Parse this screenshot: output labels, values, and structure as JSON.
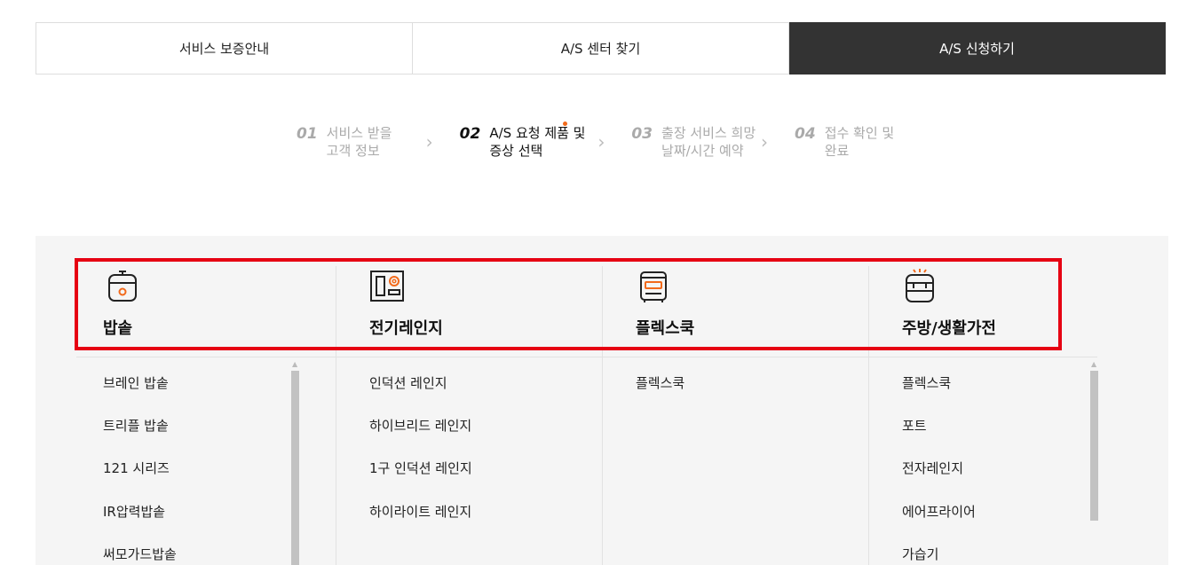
{
  "tabs": [
    {
      "label": "서비스 보증안내",
      "active": false
    },
    {
      "label": "A/S 센터 찾기",
      "active": false
    },
    {
      "label": "A/S 신청하기",
      "active": true
    }
  ],
  "steps": [
    {
      "num": "01",
      "line1": "서비스 받을",
      "line2": "고객 정보"
    },
    {
      "num": "02",
      "line1": "A/S 요청 제품 및",
      "line2": "증상 선택"
    },
    {
      "num": "03",
      "line1": "출장 서비스 희망",
      "line2": "날짜/시간 예약"
    },
    {
      "num": "04",
      "line1": "접수 확인 및",
      "line2": "완료"
    }
  ],
  "colors": {
    "accent": "#f26a1b",
    "highlight": "#e60012",
    "active_tab": "#333333",
    "panel_bg": "#f5f5f5"
  },
  "categories": [
    {
      "label": "밥솥",
      "icon": "rice-cooker-icon",
      "items": [
        "브레인 밥솥",
        "트리플 밥솥",
        "121 시리즈",
        "IR압력밥솥",
        "써모가드밥솥"
      ]
    },
    {
      "label": "전기레인지",
      "icon": "electric-range-icon",
      "items": [
        "인덕션 레인지",
        "하이브리드 레인지",
        "1구 인덕션 레인지",
        "하이라이트 레인지"
      ]
    },
    {
      "label": "플렉스쿡",
      "icon": "flexcook-icon",
      "items": [
        "플렉스쿡"
      ]
    },
    {
      "label": "주방/생활가전",
      "icon": "kitchen-appliance-icon",
      "items": [
        "플렉스쿡",
        "포트",
        "전자레인지",
        "에어프라이어",
        "가습기"
      ]
    }
  ]
}
